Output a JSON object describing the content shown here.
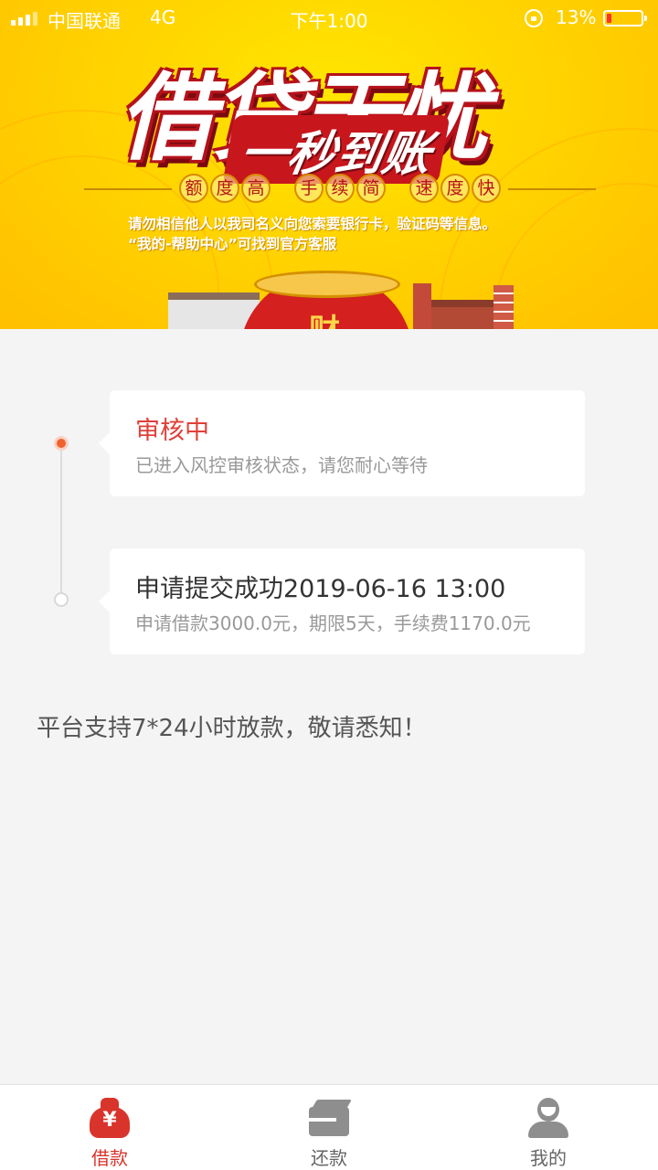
{
  "status_bar": {
    "carrier": "中国联通",
    "network": "4G",
    "time": "下午1:00",
    "battery": "13%"
  },
  "banner": {
    "title": "借贷无忧",
    "subtitle": "一秒到账",
    "features": [
      {
        "chars": [
          "额",
          "度",
          "高"
        ]
      },
      {
        "chars": [
          "手",
          "续",
          "简"
        ]
      },
      {
        "chars": [
          "速",
          "度",
          "快"
        ]
      }
    ],
    "notice_line1": "请勿相信他人以我司名义向您索要银行卡，验证码等信息。",
    "notice_line2": "“我的-帮助中心”可找到官方客服",
    "bag_char": "财"
  },
  "timeline": [
    {
      "title": "审核中",
      "desc": "已进入风控审核状态，请您耐心等待",
      "state": "active"
    },
    {
      "title": "申请提交成功2019-06-16 13:00",
      "desc": "申请借款3000.0元，期限5天，手续费1170.0元",
      "state": "inactive"
    }
  ],
  "notice": "平台支持7*24小时放款，敬请悉知！",
  "tabbar": {
    "tabs": [
      {
        "label": "借款",
        "icon": "money-bag-icon",
        "active": true
      },
      {
        "label": "还款",
        "icon": "card-icon",
        "active": false
      },
      {
        "label": "我的",
        "icon": "user-icon",
        "active": false
      }
    ]
  },
  "colors": {
    "accent": "#d9342c",
    "active_dot": "#f0622d",
    "banner_yellow": "#ffd400"
  }
}
